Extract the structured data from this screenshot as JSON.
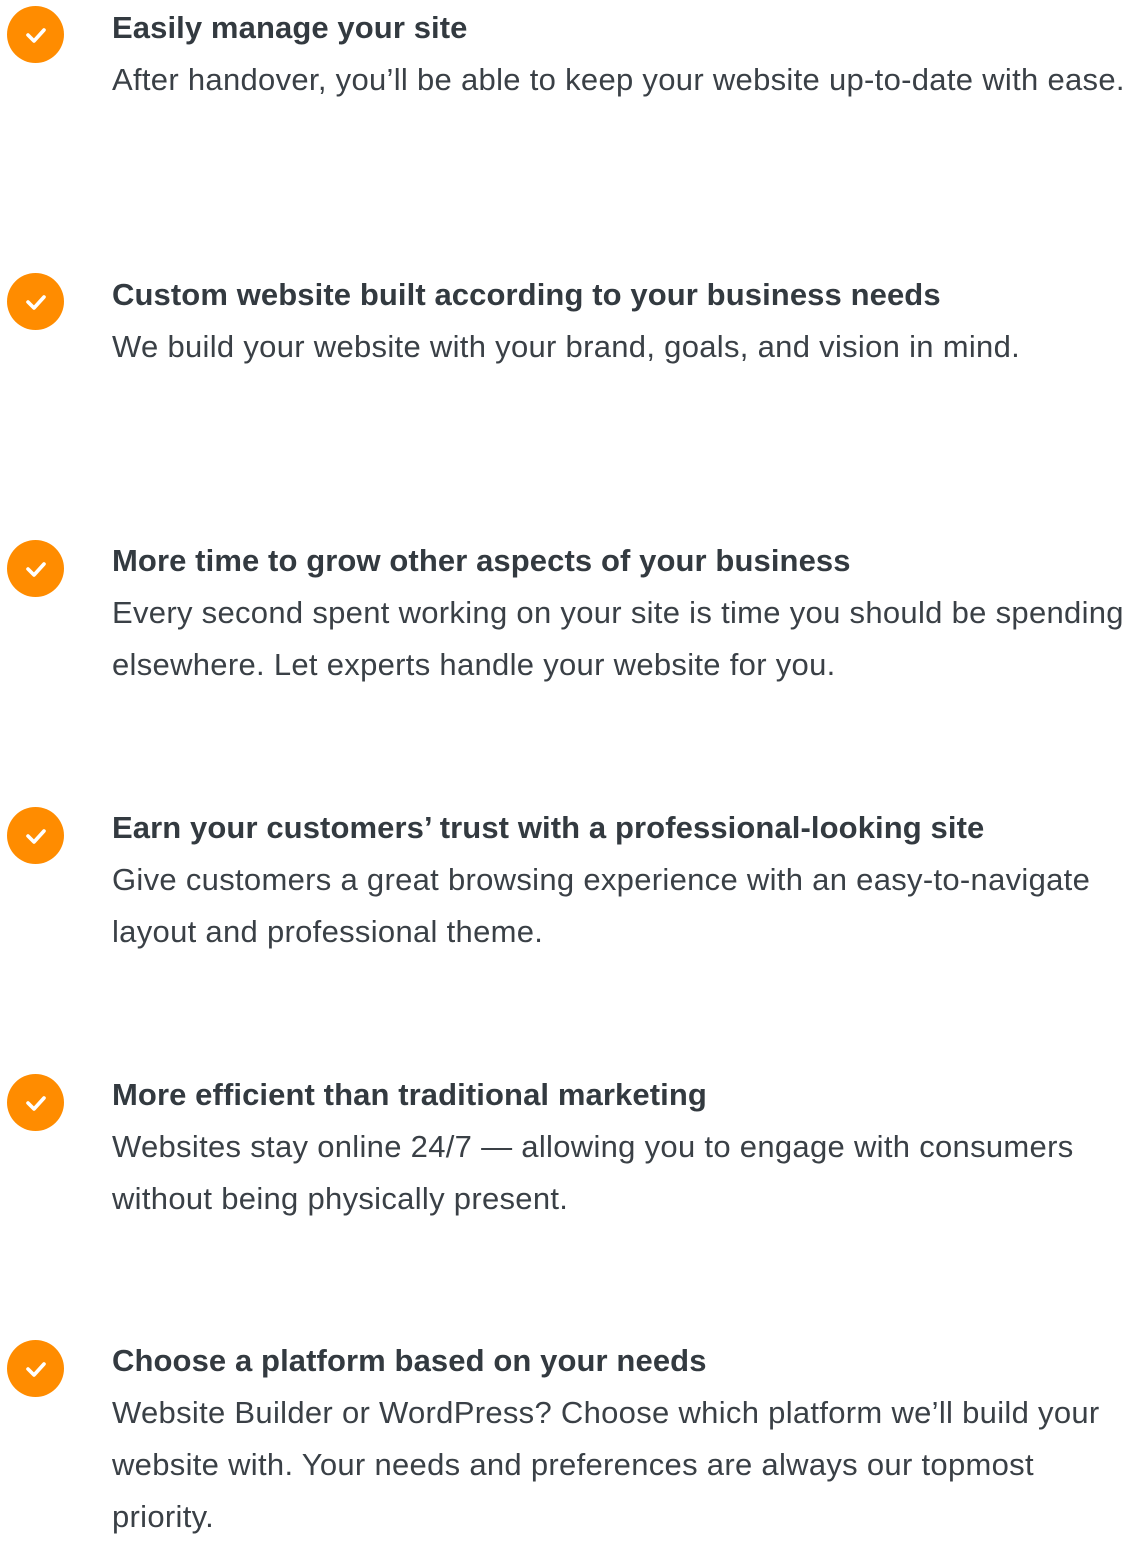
{
  "benefits": [
    {
      "title": "Easily manage your site",
      "description": "After handover, you’ll be able to keep your website up-to-date with ease."
    },
    {
      "title": "Custom website built according to your business needs",
      "description": "We build your website with your brand, goals, and vision in mind."
    },
    {
      "title": "More time to grow other aspects of your business",
      "description": "Every second spent working on your site is time you should be spending elsewhere. Let experts handle your website for you."
    },
    {
      "title": "Earn your customers’ trust with a professional-looking site",
      "description": "Give customers a great browsing experience with an easy-to-navigate layout and professional theme."
    },
    {
      "title": "More efficient than traditional marketing",
      "description": "Websites stay online 24/7 — allowing you to engage with consumers without being physically present."
    },
    {
      "title": "Choose a platform based on your needs",
      "description": "Website Builder or WordPress? Choose which platform we’ll build your website with. Your needs and preferences are always our topmost priority."
    }
  ],
  "colors": {
    "accent": "#ff8c00",
    "text": "#333a40"
  },
  "icons": {
    "bullet": "check-circle-icon"
  }
}
